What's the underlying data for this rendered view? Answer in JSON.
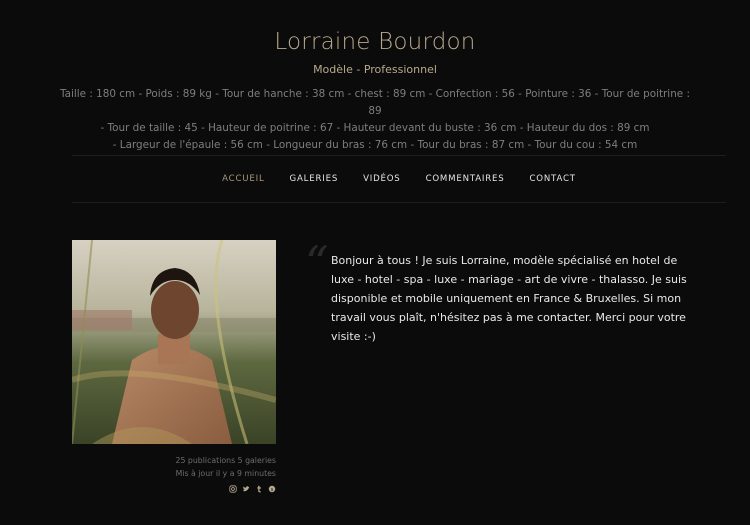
{
  "profile": {
    "name": "Lorraine Bourdon",
    "subtitle": "Modèle - Professionnel",
    "stats_lines": [
      "Taille : 180 cm - Poids : 89 kg - Tour de hanche : 38 cm - chest : 89 cm - Confection : 56 - Pointure : 36 - Tour de poitrine : 89",
      "- Tour de taille : 45 - Hauteur de poitrine : 67 - Hauteur devant du buste : 36 cm - Hauteur du dos : 89 cm",
      "- Largeur de l'épaule : 56 cm - Longueur du bras : 76 cm - Tour du bras : 87 cm - Tour du cou : 54 cm"
    ]
  },
  "nav": {
    "items": [
      {
        "label": "ACCUEIL",
        "active": true
      },
      {
        "label": "GALERIES",
        "active": false
      },
      {
        "label": "VIDÉOS",
        "active": false
      },
      {
        "label": "COMMENTAIRES",
        "active": false
      },
      {
        "label": "CONTACT",
        "active": false
      }
    ]
  },
  "gallery_meta": {
    "publications": "25 publications 5 galeries",
    "updated": "Mis à jour il y a 9 minutes"
  },
  "social_icons": [
    "instagram-icon",
    "twitter-icon",
    "tumblr-icon",
    "skype-icon"
  ],
  "bio": {
    "quote_mark": "“",
    "text": "Bonjour à tous ! Je suis Lorraine, modèle spécialisé en hotel de luxe - hotel - spa - luxe - mariage - art de vivre - thalasso. Je suis disponible et mobile uniquement en France & Bruxelles. Si mon travail vous plaît, n'hésitez pas à me contacter. Merci pour votre visite :-)"
  },
  "colors": {
    "background": "#0b0b0b",
    "accent": "#b7a98d",
    "nav_active": "#a79877",
    "text": "#e9e9e9"
  }
}
